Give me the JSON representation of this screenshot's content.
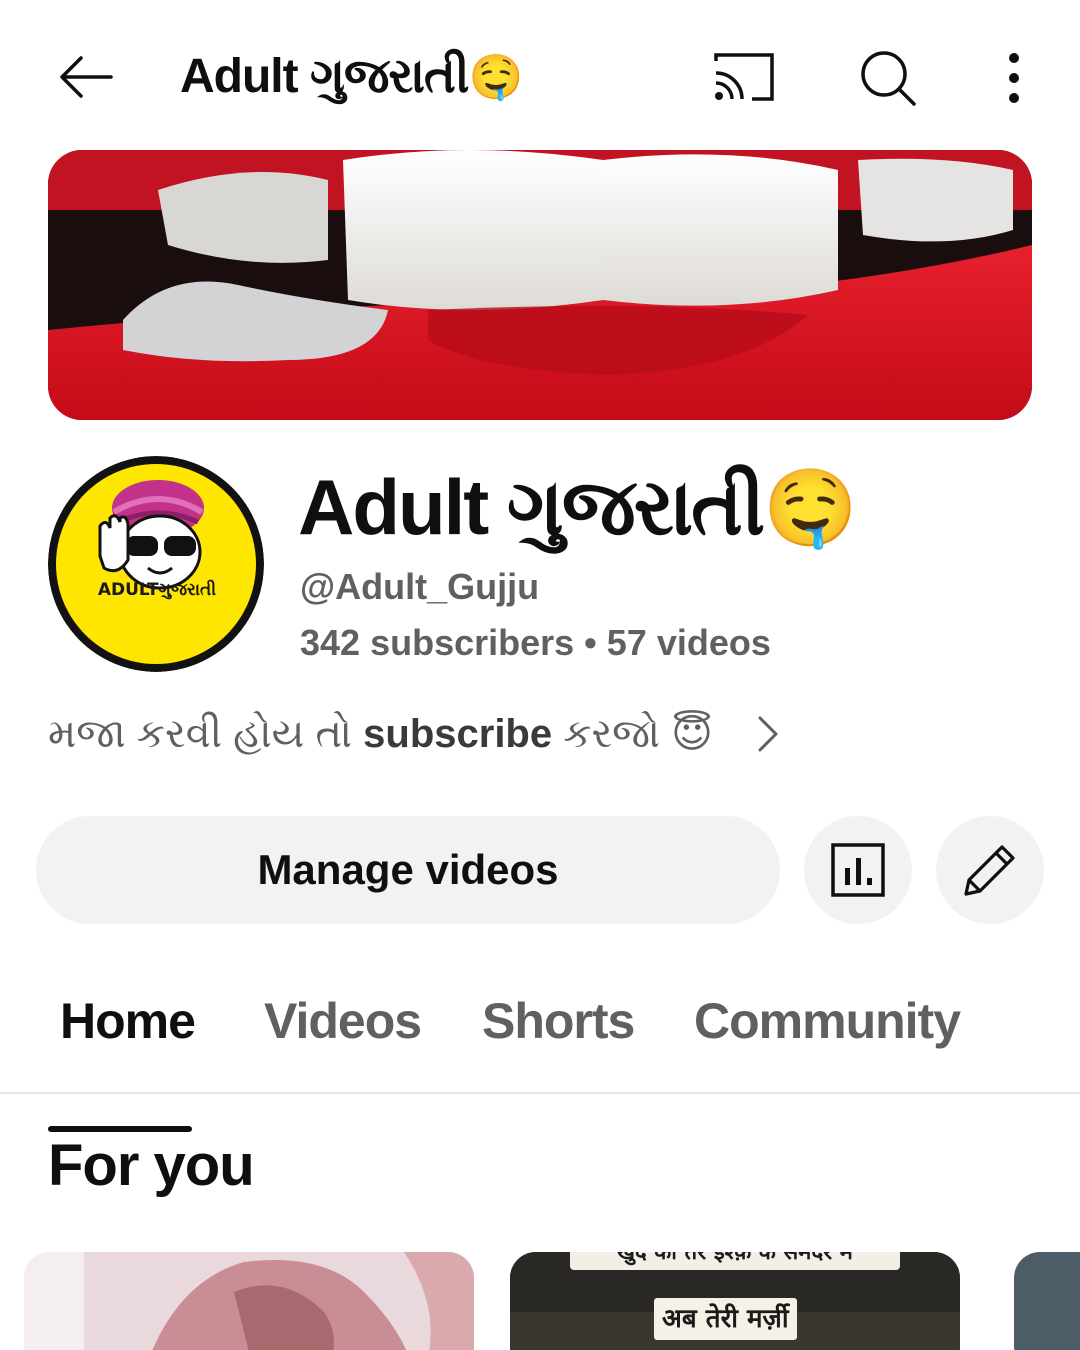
{
  "topbar": {
    "title": "Adult ગુજરાતી",
    "title_emoji": "🤤",
    "icons": [
      "back-arrow-icon",
      "cast-icon",
      "search-icon",
      "more-vertical-icon"
    ]
  },
  "channel": {
    "name": "Adult ગુજરાતી",
    "name_emoji": "🤤",
    "handle": "@Adult_Gujju",
    "subscribers": "342 subscribers",
    "separator": "•",
    "videos": "57 videos",
    "avatar_text": "ADULTગુજરાતી",
    "description_prefix": "મજા કરવી હોય તો ",
    "description_bold": "subscribe",
    "description_suffix": " કરજો ",
    "description_emoji": "😇"
  },
  "actions": {
    "manage_label": "Manage videos",
    "analytics_icon": "analytics-icon",
    "edit_icon": "pencil-icon"
  },
  "tabs": [
    {
      "label": "Home",
      "active": true
    },
    {
      "label": "Videos",
      "active": false
    },
    {
      "label": "Shorts",
      "active": false
    },
    {
      "label": "Community",
      "active": false
    }
  ],
  "section": {
    "title": "For you"
  },
  "cards": [
    {
      "caption": ""
    },
    {
      "caption_top": "खुद को तेरे इश्क़ के समंदर में",
      "caption": "अब तेरी मर्ज़ी"
    },
    {
      "caption": ""
    }
  ],
  "colors": {
    "text_primary": "#0f0f0f",
    "text_secondary": "#606060",
    "button_bg": "#f2f2f2",
    "avatar_yellow": "#ffe600",
    "banner_red": "#d8101e"
  }
}
